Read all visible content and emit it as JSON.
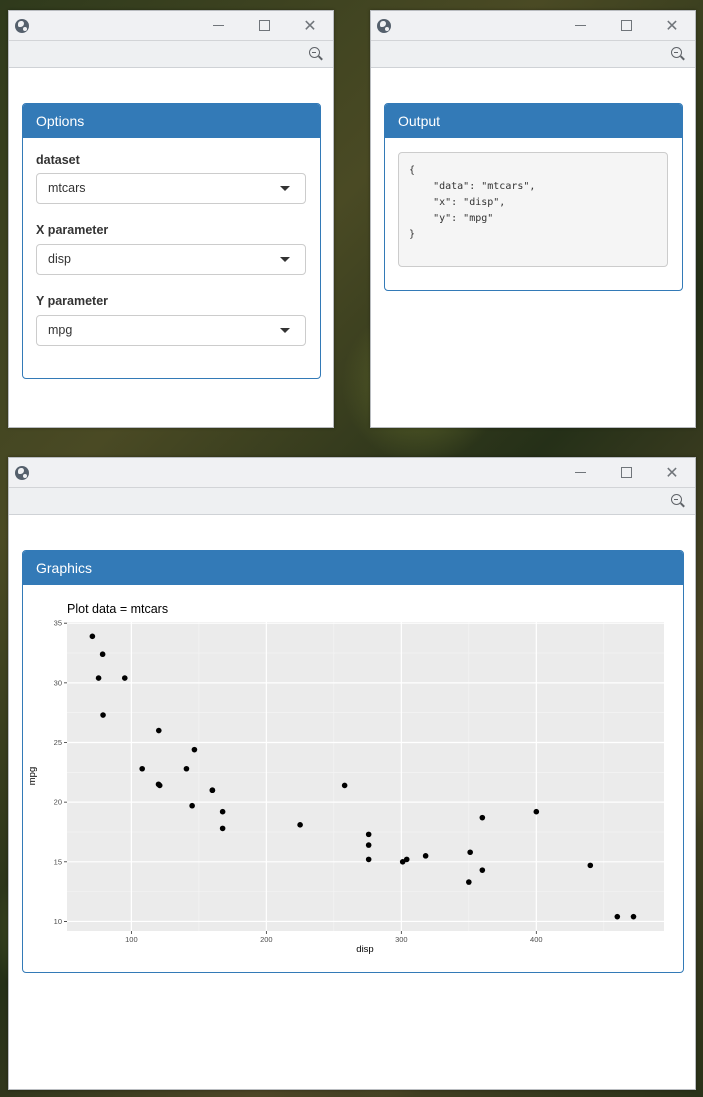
{
  "options_window": {
    "panel_title": "Options",
    "fields": [
      {
        "label": "dataset",
        "value": "mtcars"
      },
      {
        "label": "X parameter",
        "value": "disp"
      },
      {
        "label": "Y parameter",
        "value": "mpg"
      }
    ]
  },
  "output_window": {
    "panel_title": "Output",
    "code": "{\n    \"data\": \"mtcars\",\n    \"x\": \"disp\",\n    \"y\": \"mpg\"\n}"
  },
  "graphics_window": {
    "panel_title": "Graphics"
  },
  "icons": {
    "titlebar": [
      "globe-icon",
      "minimize-icon",
      "maximize-icon",
      "close-icon"
    ],
    "addressbar": [
      "zoom-out-icon"
    ]
  },
  "colors": {
    "panel_primary": "#337ab7",
    "plot_background": "#ebebeb",
    "point": "#000000"
  },
  "chart_data": {
    "type": "scatter",
    "title": "Plot data = mtcars",
    "xlabel": "disp",
    "ylabel": "mpg",
    "xlim": [
      52.3,
      494.6
    ],
    "ylim": [
      9.2,
      35.1
    ],
    "xticks": [
      100,
      200,
      300,
      400
    ],
    "yticks": [
      10,
      15,
      20,
      25,
      30,
      35
    ],
    "grid": true,
    "points": [
      {
        "x": 160,
        "y": 21.0
      },
      {
        "x": 160,
        "y": 21.0
      },
      {
        "x": 108,
        "y": 22.8
      },
      {
        "x": 258,
        "y": 21.4
      },
      {
        "x": 360,
        "y": 18.7
      },
      {
        "x": 225,
        "y": 18.1
      },
      {
        "x": 360,
        "y": 14.3
      },
      {
        "x": 146.7,
        "y": 24.4
      },
      {
        "x": 140.8,
        "y": 22.8
      },
      {
        "x": 167.6,
        "y": 19.2
      },
      {
        "x": 167.6,
        "y": 17.8
      },
      {
        "x": 275.8,
        "y": 16.4
      },
      {
        "x": 275.8,
        "y": 17.3
      },
      {
        "x": 275.8,
        "y": 15.2
      },
      {
        "x": 472,
        "y": 10.4
      },
      {
        "x": 460,
        "y": 10.4
      },
      {
        "x": 440,
        "y": 14.7
      },
      {
        "x": 78.7,
        "y": 32.4
      },
      {
        "x": 75.7,
        "y": 30.4
      },
      {
        "x": 71.1,
        "y": 33.9
      },
      {
        "x": 120.1,
        "y": 21.5
      },
      {
        "x": 318,
        "y": 15.5
      },
      {
        "x": 304,
        "y": 15.2
      },
      {
        "x": 350,
        "y": 13.3
      },
      {
        "x": 400,
        "y": 19.2
      },
      {
        "x": 79,
        "y": 27.3
      },
      {
        "x": 120.3,
        "y": 26.0
      },
      {
        "x": 95.1,
        "y": 30.4
      },
      {
        "x": 351,
        "y": 15.8
      },
      {
        "x": 145,
        "y": 19.7
      },
      {
        "x": 301,
        "y": 15.0
      },
      {
        "x": 121,
        "y": 21.4
      }
    ]
  }
}
